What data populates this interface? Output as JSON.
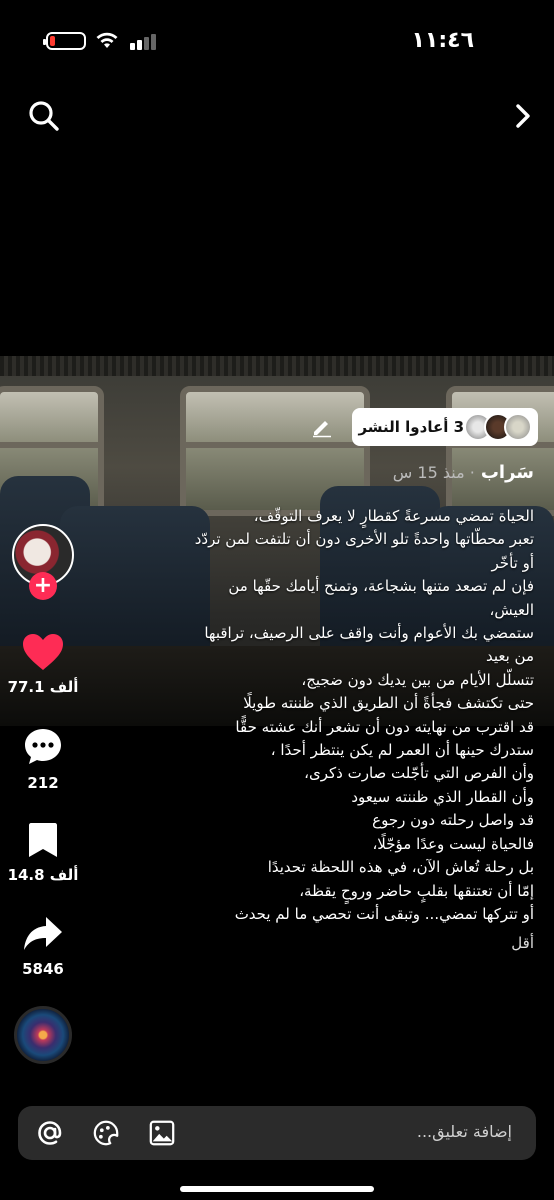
{
  "status_bar": {
    "time": "١١:٤٦",
    "battery_level": 0.15
  },
  "top_bar": {
    "search_icon": "search-icon",
    "next_icon": "chevron-right-icon"
  },
  "repost": {
    "label": "3 أعادوا النشر"
  },
  "post": {
    "author": "سَراب",
    "time": "· منذ 15 س",
    "caption_lines": [
      "الحياة تمضي مسرعةً كقطارٍ لا يعرف التوقّف،",
      "تعبر محطّاتها واحدةً تلو الأخرى دون أن تلتفت لمن تردّد",
      "أو تأخّر",
      "فإن لم تصعد متنها بشجاعة، وتمنح أيامك حقّها من",
      "العيش،",
      "ستمضي بك الأعوام وأنت واقف على الرصيف، تراقبها",
      "من بعيد",
      "تتسلّل الأيام من بين يديك دون ضجيج،",
      "حتى تكتشف فجأةً أن الطريق الذي ظننته طويلًا",
      "قد اقترب من نهايته دون أن تشعر أنك عشته حقًّا",
      "ستدرك حينها أن العمر لم يكن ينتظر أحدًا ،",
      "وأن الفرص التي تأجّلت صارت ذكرى،",
      "وأن القطار الذي ظننته سيعود",
      "قد واصل رحلته دون رجوع",
      "فالحياة ليست وعدًا مؤجّلًا،",
      "بل رحلة تُعاش الآن، في هذه اللحظة تحديدًا",
      "إمّا أن تعتنقها بقلبٍ حاضر وروحٍ يقظة،",
      "أو تتركها تمضي... وتبقى أنت تحصي ما لم يحدث"
    ],
    "less_label": "أقل"
  },
  "actions": {
    "likes": "77.1 ألف",
    "comments": "212",
    "saves": "14.8 ألف",
    "shares": "5846"
  },
  "comment_bar": {
    "placeholder": "إضافة تعليق..."
  },
  "colors": {
    "like": "#fe2c55",
    "follow": "#fe2c55",
    "comment_bar_bg": "#2b2b2b"
  }
}
